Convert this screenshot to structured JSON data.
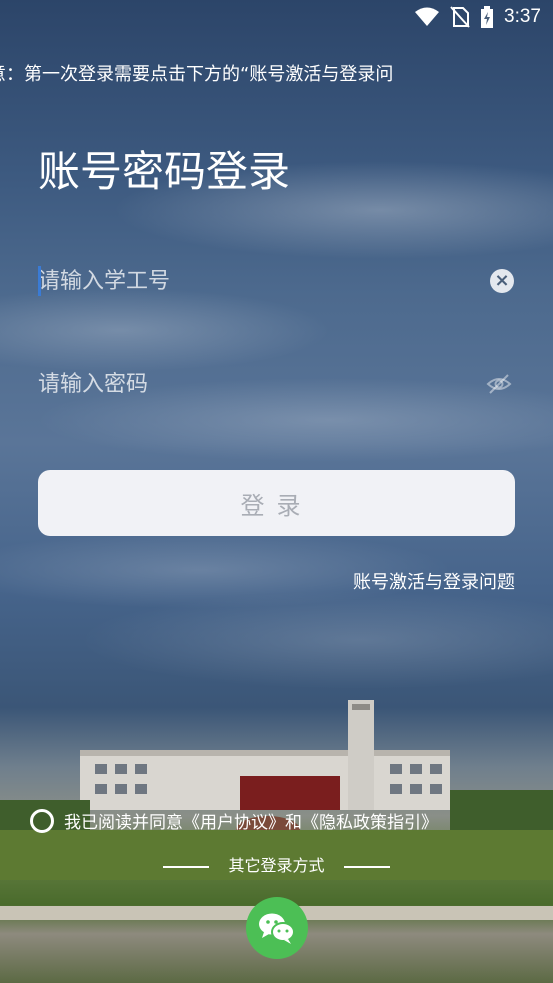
{
  "status_bar": {
    "time": "3:37"
  },
  "notice": {
    "text": "意：第一次登录需要点击下方的“账号激活与登录问"
  },
  "page": {
    "title": "账号密码登录"
  },
  "form": {
    "account_placeholder": "请输入学工号",
    "password_placeholder": "请输入密码",
    "login_label": "登录"
  },
  "links": {
    "help": "账号激活与登录问题"
  },
  "agreement": {
    "prefix": "我已阅读并同意",
    "user_agreement": "《用户协议》",
    "and": "和",
    "privacy": "《隐私政策指引》"
  },
  "other_login": {
    "label": "其它登录方式"
  },
  "colors": {
    "accent": "#3a7bd5",
    "wechat": "#4cbf55",
    "button_bg": "#f1f2f6"
  },
  "icons": [
    "wifi-icon",
    "no-sim-icon",
    "battery-icon",
    "clear-icon",
    "eye-off-icon",
    "wechat-icon"
  ]
}
